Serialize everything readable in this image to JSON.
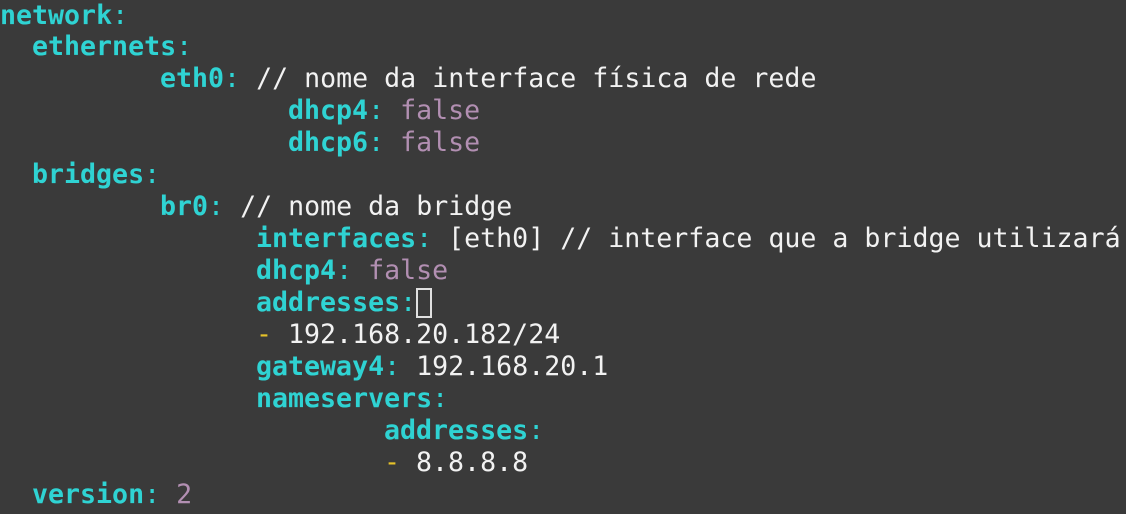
{
  "lines": {
    "l1": {
      "key": "network",
      "sep": ":"
    },
    "l2": {
      "key": "ethernets",
      "sep": ":"
    },
    "l3": {
      "key": "eth0",
      "sep": ":",
      "comment": " // nome da interface física de rede"
    },
    "l4": {
      "key": "dhcp4",
      "sep": ": ",
      "value": "false"
    },
    "l5": {
      "key": "dhcp6",
      "sep": ": ",
      "value": "false"
    },
    "l6": {
      "key": "bridges",
      "sep": ":"
    },
    "l7": {
      "key": "br0",
      "sep": ":",
      "comment": " // nome da bridge"
    },
    "l8": {
      "key": "interfaces",
      "sep": ": ",
      "value": "[eth0] // interface que a bridge utilizará"
    },
    "l9": {
      "key": "dhcp4",
      "sep": ": ",
      "value": "false"
    },
    "l10": {
      "key": "addresses",
      "sep": ":"
    },
    "l11": {
      "dash": "-",
      "value": " 192.168.20.182/24"
    },
    "l12": {
      "key": "gateway4",
      "sep": ": ",
      "value": "192.168.20.1"
    },
    "l13": {
      "key": "nameservers",
      "sep": ":"
    },
    "l14": {
      "key": "addresses",
      "sep": ":"
    },
    "l15": {
      "dash": "-",
      "value": " 8.8.8.8"
    },
    "l16": {
      "key": "version",
      "sep": ": ",
      "value": "2"
    }
  },
  "colors": {
    "background": "#3a3a3a",
    "key": "#2fd3d3",
    "text": "#f2f2f2",
    "literal": "#b28fb2",
    "dash": "#e6c229"
  }
}
